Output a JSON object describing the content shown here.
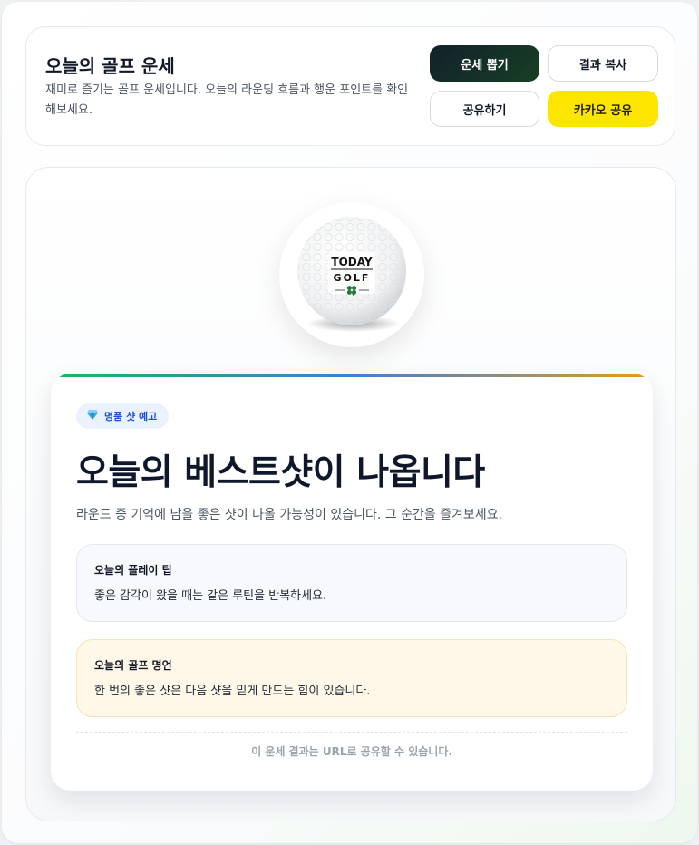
{
  "header": {
    "title": "오늘의 골프 운세",
    "subtitle": "재미로 즐기는 골프 운세입니다. 오늘의 라운딩 흐름과 행운 포인트를 확인해보세요.",
    "buttons": {
      "draw": "운세 뽑기",
      "copy": "결과 복사",
      "share": "공유하기",
      "kakao": "카카오 공유"
    }
  },
  "ball": {
    "line1": "TODAY",
    "line2": "GOLF",
    "emblem": "clover-icon"
  },
  "result": {
    "badge": "명품 샷 예고",
    "badge_icon": "gem-icon",
    "title": "오늘의 베스트샷이 나옵니다",
    "description": "라운드 중 기억에 남을 좋은 샷이 나올 가능성이 있습니다. 그 순간을 즐겨보세요.",
    "play_tip": {
      "label": "오늘의 플레이 팁",
      "text": "좋은 감각이 왔을 때는 같은 루틴을 반복하세요."
    },
    "golf_quote": {
      "label": "오늘의 골프 명언",
      "text": "한 번의 좋은 샷은 다음 샷을 믿게 만드는 힘이 있습니다."
    },
    "footer": "이 운세 결과는 URL로 공유할 수 있습니다."
  },
  "colors": {
    "kakao": "#fee500",
    "primary_dark": "#13202b",
    "primary_green": "#163f24",
    "badge_text": "#1d4ed8",
    "quote_bg": "#fff8e8"
  }
}
